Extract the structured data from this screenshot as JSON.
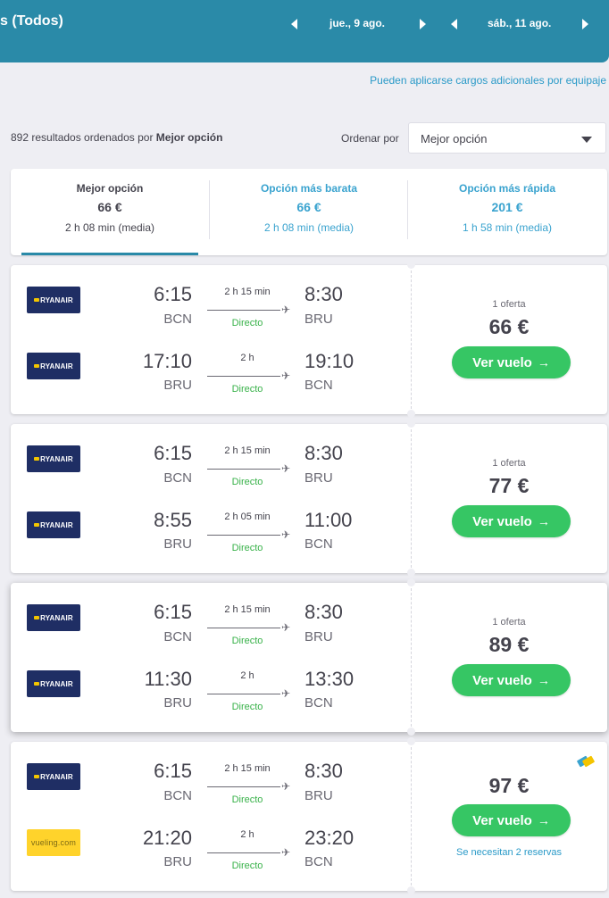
{
  "header": {
    "title": "s (Todos)",
    "depart_date": "jue., 9 ago.",
    "return_date": "sáb., 11 ago."
  },
  "notice": "Pueden aplicarse cargos adicionales por equipaje",
  "results": {
    "count_prefix": "892 resultados ordenados por ",
    "sort_bold": "Mejor opción",
    "sort_label": "Ordenar por",
    "sort_value": "Mejor opción"
  },
  "tabs": [
    {
      "title": "Mejor opción",
      "price": "66 €",
      "duration": "2 h 08 min (media)"
    },
    {
      "title": "Opción más barata",
      "price": "66 €",
      "duration": "2 h 08 min (media)"
    },
    {
      "title": "Opción más rápida",
      "price": "201 €",
      "duration": "1 h 58 min (media)"
    }
  ],
  "cards": [
    {
      "legs": [
        {
          "airline": "RYANAIR",
          "dep_time": "6:15",
          "dep_ap": "BCN",
          "duration": "2 h 15 min",
          "stops": "Directo",
          "arr_time": "8:30",
          "arr_ap": "BRU"
        },
        {
          "airline": "RYANAIR",
          "dep_time": "17:10",
          "dep_ap": "BRU",
          "duration": "2 h",
          "stops": "Directo",
          "arr_time": "19:10",
          "arr_ap": "BCN"
        }
      ],
      "offers": "1 oferta",
      "price": "66 €",
      "button": "Ver vuelo"
    },
    {
      "legs": [
        {
          "airline": "RYANAIR",
          "dep_time": "6:15",
          "dep_ap": "BCN",
          "duration": "2 h 15 min",
          "stops": "Directo",
          "arr_time": "8:30",
          "arr_ap": "BRU"
        },
        {
          "airline": "RYANAIR",
          "dep_time": "8:55",
          "dep_ap": "BRU",
          "duration": "2 h 05 min",
          "stops": "Directo",
          "arr_time": "11:00",
          "arr_ap": "BCN"
        }
      ],
      "offers": "1 oferta",
      "price": "77 €",
      "button": "Ver vuelo"
    },
    {
      "legs": [
        {
          "airline": "RYANAIR",
          "dep_time": "6:15",
          "dep_ap": "BCN",
          "duration": "2 h 15 min",
          "stops": "Directo",
          "arr_time": "8:30",
          "arr_ap": "BRU"
        },
        {
          "airline": "RYANAIR",
          "dep_time": "11:30",
          "dep_ap": "BRU",
          "duration": "2 h",
          "stops": "Directo",
          "arr_time": "13:30",
          "arr_ap": "BCN"
        }
      ],
      "offers": "1 oferta",
      "price": "89 €",
      "button": "Ver vuelo"
    },
    {
      "legs": [
        {
          "airline": "RYANAIR",
          "dep_time": "6:15",
          "dep_ap": "BCN",
          "duration": "2 h 15 min",
          "stops": "Directo",
          "arr_time": "8:30",
          "arr_ap": "BRU"
        },
        {
          "airline": "vueling.com",
          "dep_time": "21:20",
          "dep_ap": "BRU",
          "duration": "2 h",
          "stops": "Directo",
          "arr_time": "23:20",
          "arr_ap": "BCN"
        }
      ],
      "price": "97 €",
      "button": "Ver vuelo",
      "note": "Se necesitan 2 reservas"
    }
  ],
  "icons": {
    "arrow": "→",
    "plane": "✈"
  }
}
